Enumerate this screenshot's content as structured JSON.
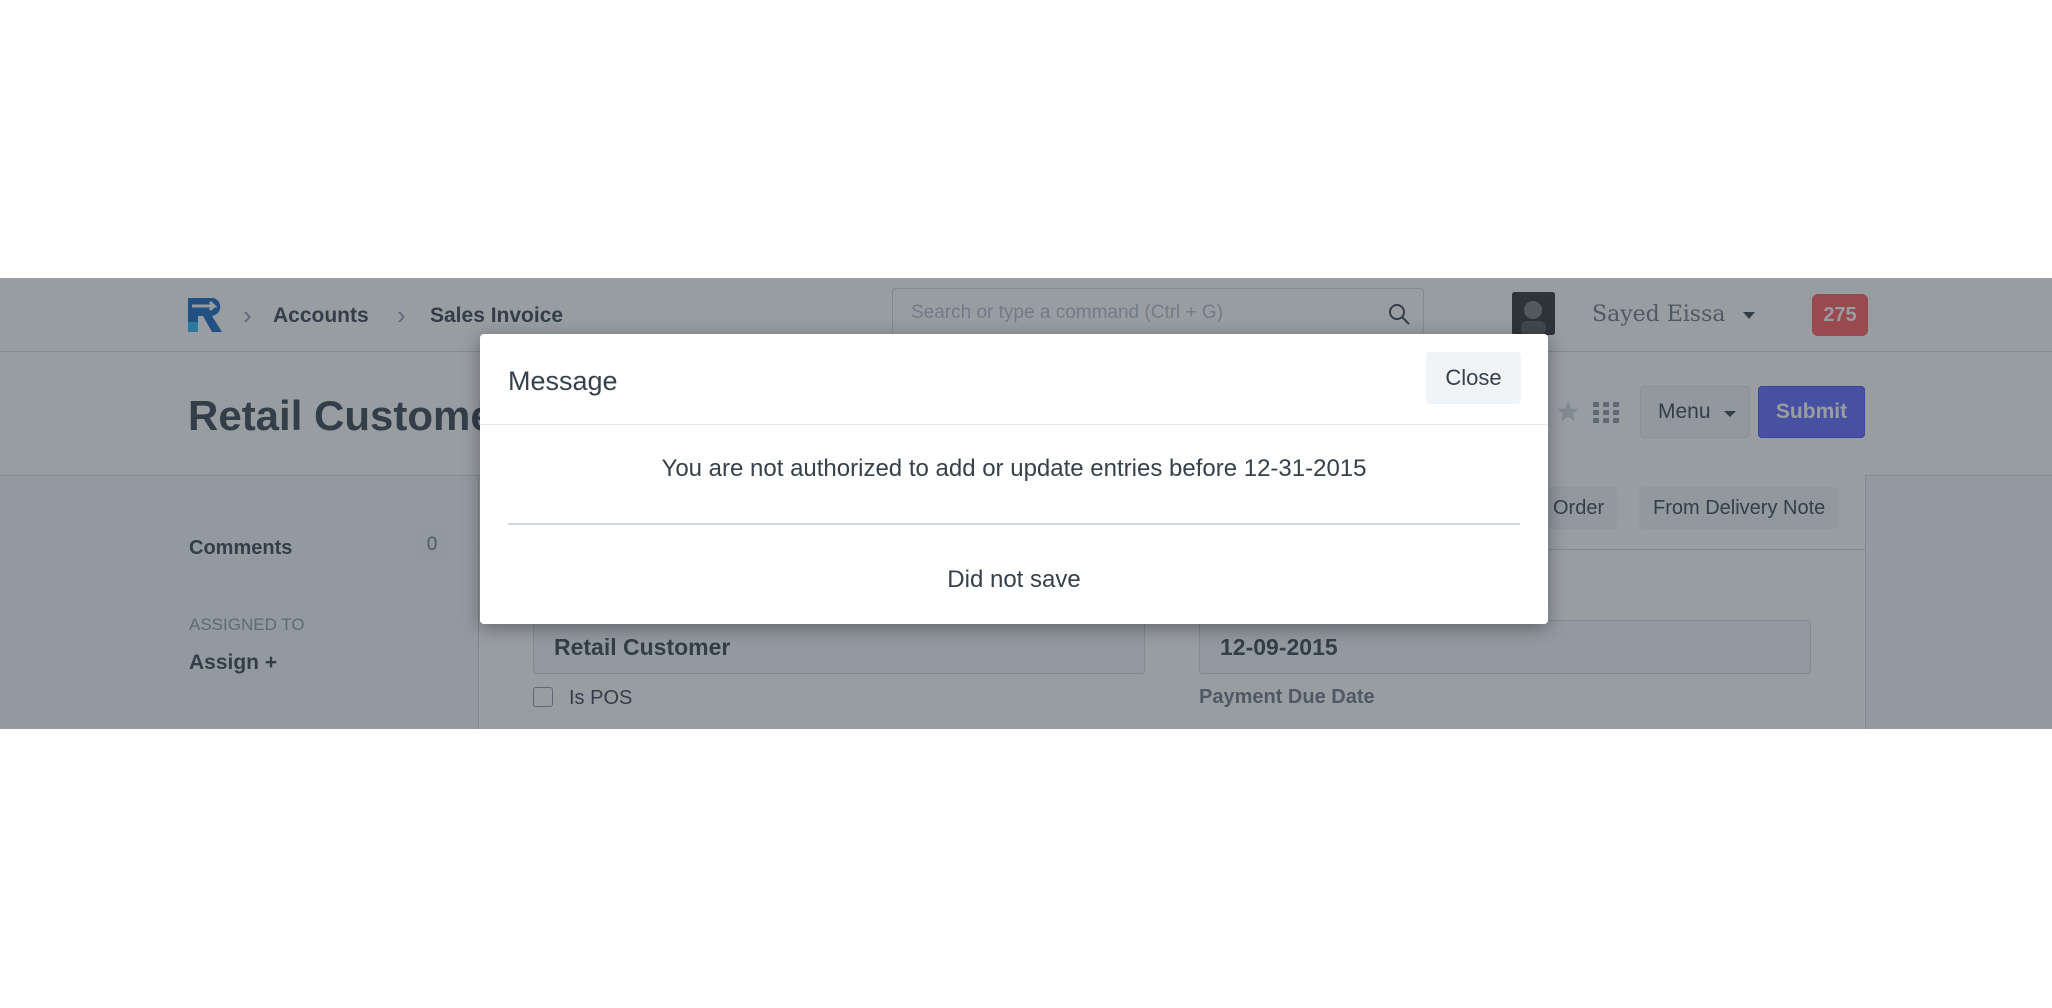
{
  "navbar": {
    "breadcrumbs": [
      "Accounts",
      "Sales Invoice"
    ],
    "search_placeholder": "Search or type a command (Ctrl + G)",
    "user_name": "Sayed Eissa",
    "notification_count": "275"
  },
  "page": {
    "title": "Retail Customer",
    "menu_label": "Menu",
    "submit_label": "Submit"
  },
  "sidebar": {
    "comments_label": "Comments",
    "comments_count": "0",
    "assigned_to_label": "ASSIGNED TO",
    "assign_label": "Assign +"
  },
  "form": {
    "toolbar_buttons": [
      "Order",
      "From Delivery Note"
    ],
    "customer_value": "Retail Customer",
    "date_value": "12-09-2015",
    "is_pos_label": "Is POS",
    "payment_due_label": "Payment Due Date"
  },
  "modal": {
    "title": "Message",
    "close_label": "Close",
    "message": "You are not authorized to add or update entries before 12-31-2015",
    "sub_message": "Did not save"
  },
  "colors": {
    "submit": "#5e64ff",
    "badge": "#ff5858",
    "overlay": "rgba(50,60,70,0.5)"
  }
}
